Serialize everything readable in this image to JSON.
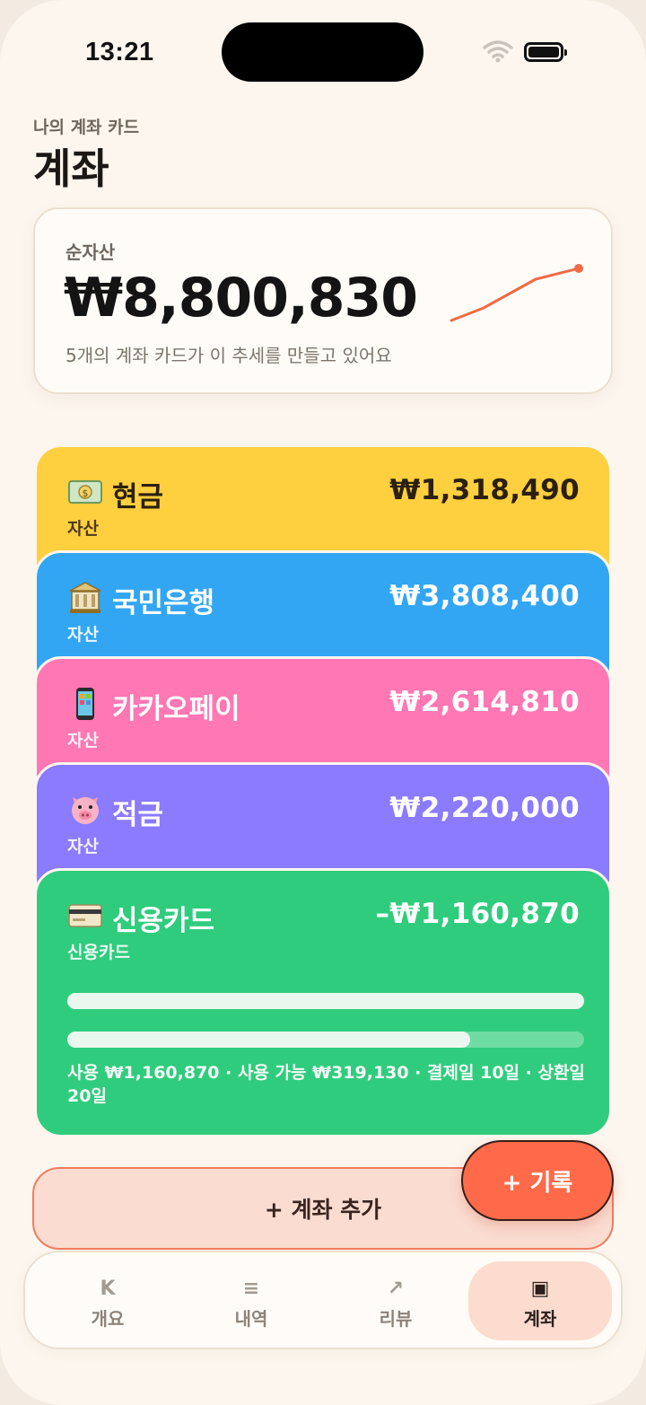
{
  "status": {
    "time": "13:21"
  },
  "header": {
    "subtitle": "나의 계좌 카드",
    "title": "계좌"
  },
  "net_worth": {
    "label": "순자산",
    "value": "₩8,800,830",
    "description": "5개의 계좌 카드가 이 추세를 만들고 있어요",
    "trend_color": "#f06a45"
  },
  "accounts": [
    {
      "emoji": "money-bag-emoji",
      "name": "현금",
      "type": "자산",
      "amount": "₩1,318,490",
      "color": "#fecf3f",
      "text_color": "#2b2010"
    },
    {
      "emoji": "bank-emoji",
      "name": "국민은행",
      "type": "자산",
      "amount": "₩3,808,400",
      "color": "#33a6f3",
      "text_color": "#ffffff"
    },
    {
      "emoji": "phone-emoji",
      "name": "카카오페이",
      "type": "자산",
      "amount": "₩2,614,810",
      "color": "#ff77b3",
      "text_color": "#ffffff"
    },
    {
      "emoji": "pig-emoji",
      "name": "적금",
      "type": "자산",
      "amount": "₩2,220,000",
      "color": "#8a7bff",
      "text_color": "#ffffff"
    },
    {
      "emoji": "credit-card-emoji",
      "name": "신용카드",
      "type": "신용카드",
      "amount": "–₩1,160,870",
      "color": "#30cc7d",
      "text_color": "#ffffff"
    }
  ],
  "credit": {
    "bars": [
      1.0,
      0.78
    ],
    "description": "사용 ₩1,160,870 · 사용 가능 ₩319,130 · 결제일 10일 · 상환일 20일"
  },
  "actions": {
    "add_account": "+ 계좌 추가",
    "record": "+ 기록"
  },
  "tabs": [
    {
      "icon": "K",
      "label": "개요",
      "active": false
    },
    {
      "icon": "≡",
      "label": "내역",
      "active": false
    },
    {
      "icon": "↗",
      "label": "리뷰",
      "active": false
    },
    {
      "icon": "▣",
      "label": "계좌",
      "active": true
    }
  ]
}
